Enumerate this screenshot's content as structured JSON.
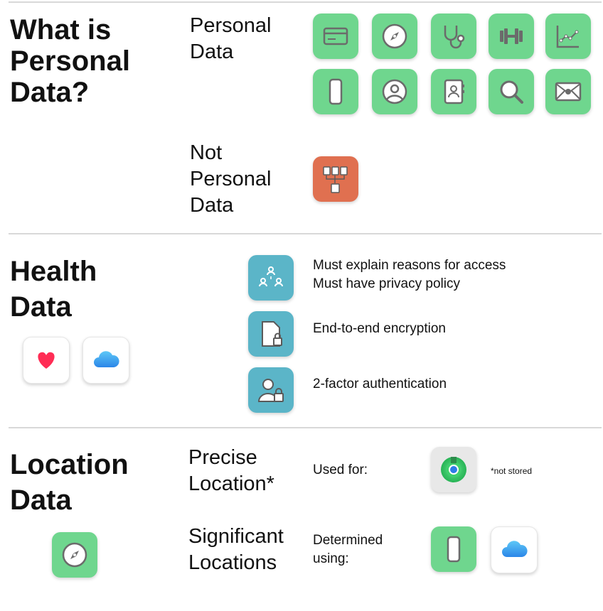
{
  "sections": {
    "personal": {
      "title_lines": [
        "What is",
        "Personal",
        "Data?"
      ],
      "personal_label_lines": [
        "Personal",
        "Data"
      ],
      "not_personal_label_lines": [
        "Not",
        "Personal",
        "Data"
      ],
      "icons": [
        "credit-card-icon",
        "compass-icon",
        "stethoscope-icon",
        "dumbbell-icon",
        "line-chart-icon",
        "phone-icon",
        "user-circle-icon",
        "contacts-book-icon",
        "search-icon",
        "apple-mail-icon"
      ],
      "not_personal_icon": "aggregate-documents-icon"
    },
    "health": {
      "title_lines": [
        "Health",
        "Data"
      ],
      "requirements": [
        {
          "icon": "people-network-icon",
          "lines": [
            "Must explain reasons for access",
            "Must have privacy policy"
          ]
        },
        {
          "icon": "locked-document-icon",
          "lines": [
            "End-to-end encryption"
          ]
        },
        {
          "icon": "locked-user-icon",
          "lines": [
            "2-factor authentication"
          ]
        }
      ],
      "app_icons": [
        "health-heart-icon",
        "icloud-icon"
      ]
    },
    "location": {
      "title_lines": [
        "Location",
        "Data"
      ],
      "precise_label_lines": [
        "Precise",
        "Location*"
      ],
      "significant_label_lines": [
        "Significant",
        "Locations"
      ],
      "used_for": "Used for:",
      "determined_lines": [
        "Determined",
        "using:"
      ],
      "footnote": "*not stored",
      "icons": [
        "find-my-icon",
        "phone-icon",
        "icloud-icon",
        "compass-icon"
      ]
    }
  },
  "colors": {
    "green": "#6fd68e",
    "orange": "#e07050",
    "teal": "#5bb5c8",
    "icon_gray": "#6b6b6b",
    "heart_red": "#ff2d55",
    "icloud_blue": "#3aa0f0"
  }
}
